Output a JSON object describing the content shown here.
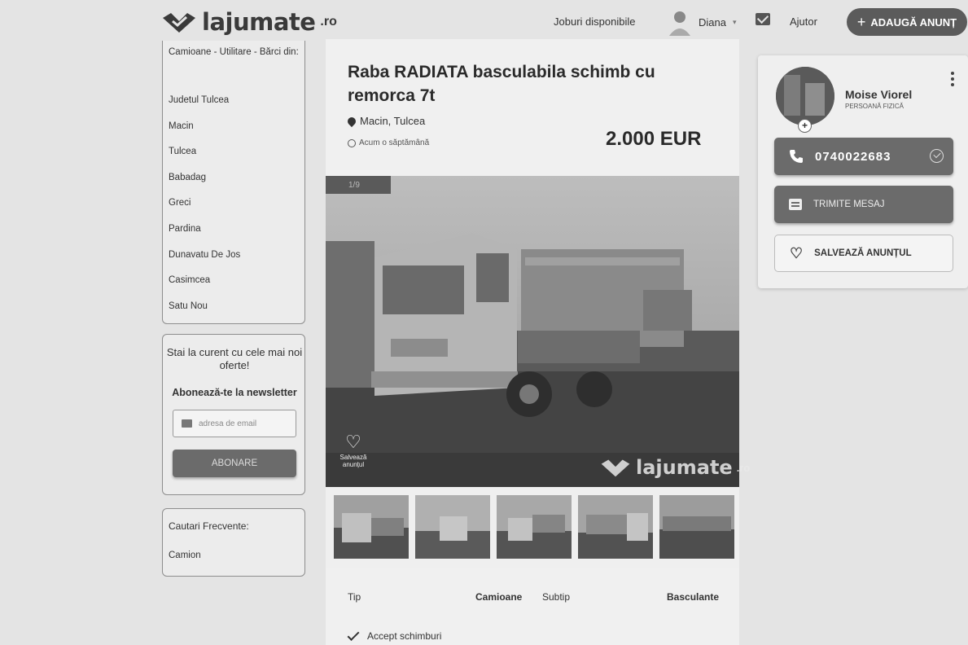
{
  "header": {
    "logo_text": "lajumate",
    "logo_tld": ".ro",
    "nav_jobs": "Joburi disponibile",
    "user_name": "Diana",
    "help": "Ajutor",
    "add_button": "ADAUGĂ ANUNȚ"
  },
  "sidebar": {
    "category_heading": "Camioane - Utilitare - Bărci din:",
    "locations": [
      "Judetul Tulcea",
      "Macin",
      "Tulcea",
      "Babadag",
      "Greci",
      "Pardina",
      "Dunavatu De Jos",
      "Casimcea",
      "Satu Nou"
    ],
    "newsletter_title": "Stai la curent cu cele mai noi oferte!",
    "newsletter_sub": "Abonează-te la newsletter",
    "email_placeholder": "adresa de email",
    "subscribe_button": "ABONARE",
    "frequent_title": "Cautari Frecvente:",
    "frequent_item": "Camion"
  },
  "ad": {
    "title": "Raba RADIATA basculabila schimb cu remorca 7t",
    "location": "Macin, Tulcea",
    "posted": "Acum o săptămână",
    "price": "2.000 EUR",
    "photo_counter": "1/9",
    "save_label": "Salvează anunțul",
    "watermark_text": "lajumate",
    "watermark_tld": ".ro",
    "specs": {
      "tip_label": "Tip",
      "tip_value": "Camioane",
      "subtip_label": "Subtip",
      "subtip_value": "Basculante"
    },
    "accept": "Accept schimburi"
  },
  "seller": {
    "name": "Moise Viorel",
    "type": "PERSOANĂ FIZICĂ",
    "phone": "0740022683",
    "message_button": "TRIMITE MESAJ",
    "save_button": "SALVEAZĂ ANUNȚUL"
  },
  "icons": {
    "logo": "heart-check-logo-icon",
    "user": "user-avatar-icon",
    "mail": "mail-icon",
    "plus": "plus-icon",
    "pin": "location-pin-icon",
    "clock": "clock-icon",
    "heart": "heart-icon",
    "phone": "phone-icon",
    "verified": "check-circle-icon",
    "message": "message-icon",
    "check": "check-icon",
    "menu": "kebab-menu-icon"
  }
}
